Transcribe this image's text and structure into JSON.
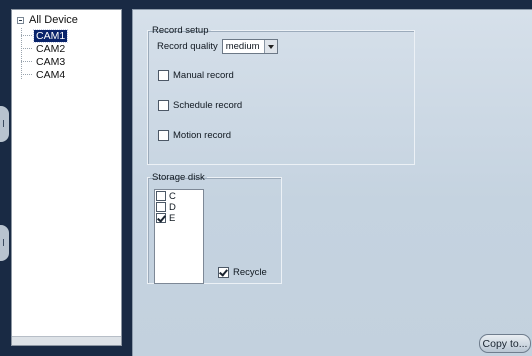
{
  "tree": {
    "root_label": "All Device",
    "items": [
      {
        "label": "CAM1",
        "selected": true
      },
      {
        "label": "CAM2",
        "selected": false
      },
      {
        "label": "CAM3",
        "selected": false
      },
      {
        "label": "CAM4",
        "selected": false
      }
    ]
  },
  "record_setup": {
    "title": "Record setup",
    "quality_label": "Record quality",
    "quality_value": "medium",
    "manual_label": "Manual record",
    "manual_checked": false,
    "schedule_label": "Schedule record",
    "schedule_checked": false,
    "motion_label": "Motion record",
    "motion_checked": false
  },
  "storage_disk": {
    "title": "Storage disk",
    "disks": [
      {
        "label": "C",
        "checked": false
      },
      {
        "label": "D",
        "checked": false
      },
      {
        "label": "E",
        "checked": true
      }
    ],
    "recycle_label": "Recycle",
    "recycle_checked": true
  },
  "copy_button_label": "Copy to...",
  "colors": {
    "frame": "#192a44",
    "selection": "#0a246a",
    "panel_gradient_top": "#d6e0ea",
    "panel_gradient_bottom": "#c3d1de"
  }
}
